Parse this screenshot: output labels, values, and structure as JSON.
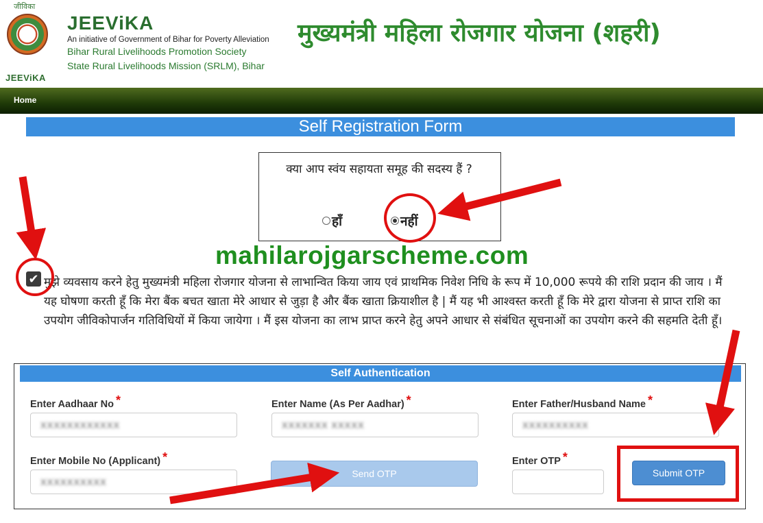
{
  "header": {
    "logo_top_text": "जीविका",
    "logo_bottom_text": "JEEViKA",
    "org_name": "JEEViKA",
    "org_line1": "An initiative of Government of Bihar for Poverty Alleviation",
    "org_line2": "Bihar Rural Livelihoods Promotion Society",
    "org_line3": "State Rural Livelihoods Mission (SRLM), Bihar",
    "scheme_title": "मुख्यमंत्री महिला रोजगार योजना (शहरी)"
  },
  "nav": {
    "home_label": "Home"
  },
  "form": {
    "title": "Self Registration Form",
    "shg_question": "क्या आप स्वंय सहायता समूह की सदस्य हैं ?",
    "shg_options": [
      {
        "label": "हाँ",
        "selected": false
      },
      {
        "label": "नहीं",
        "selected": true
      }
    ],
    "watermark": "mahilarojgarscheme.com",
    "declaration_checked": true,
    "declaration_text": "मुझे व्यवसाय करने हेतु मुख्यमंत्री महिला रोजगार योजना से लाभान्वित किया जाय एवं प्राथमिक निवेश निधि के रूप में 10,000 रूपये की राशि प्रदान की जाय । मैं यह घोषणा करती हूँ कि मेरा बैंक बचत खाता मेरे आधार से जुड़ा है और बैंक खाता क्रियाशील है | मैं यह भी आश्वस्त करती हूँ कि मेरे द्वारा योजना से प्राप्त राशि का उपयोग जीविकोपार्जन गतिविधियों में किया जायेगा । मैं इस योजना का लाभ प्राप्त करने हेतु अपने आधार से संबंधित सूचनाओं का उपयोग करने की सहमति देती हूँ।"
  },
  "auth": {
    "title": "Self Authentication",
    "required_mark": "*",
    "aadhaar": {
      "label": "Enter Aadhaar No",
      "value": "XXXXXXXXXXXX"
    },
    "name": {
      "label": "Enter Name (As Per Aadhar)",
      "value": "XXXXXXX XXXXX"
    },
    "father": {
      "label": "Enter Father/Husband Name",
      "value": "XXXXXXXXXX"
    },
    "mobile": {
      "label": "Enter Mobile No (Applicant)",
      "value": "XXXXXXXXXX"
    },
    "otp": {
      "label": "Enter OTP",
      "value": ""
    },
    "send_otp_label": "Send OTP",
    "submit_otp_label": "Submit OTP"
  },
  "colors": {
    "brand_green": "#2e8b2e",
    "title_bar_blue": "#3c8fde",
    "annotation_red": "#e01010",
    "nav_dark_green": "#1f3a08"
  }
}
